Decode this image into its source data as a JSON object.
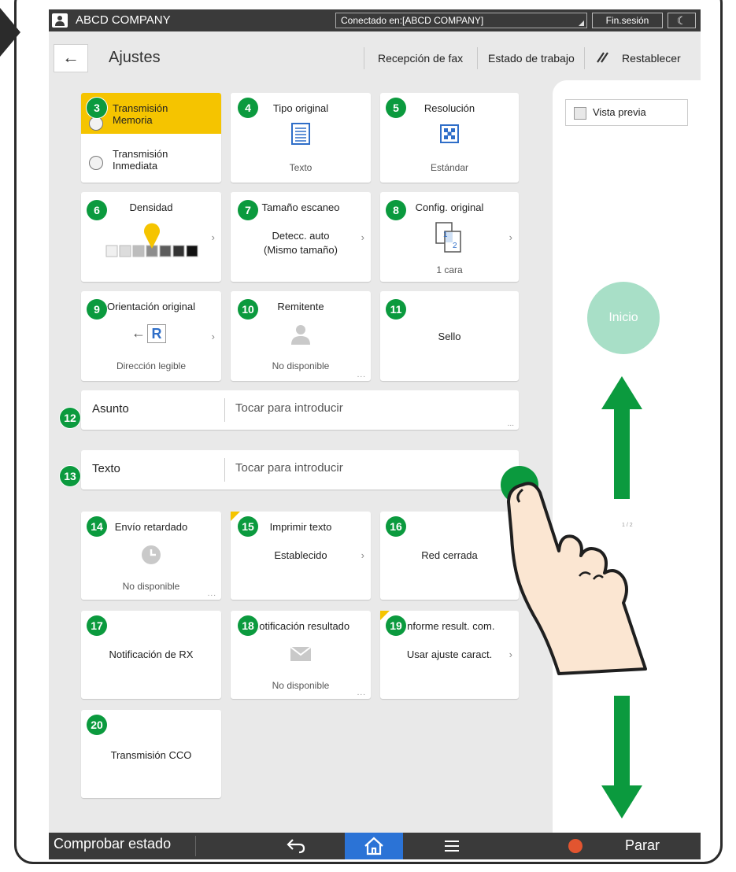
{
  "topbar": {
    "company": "ABCD COMPANY",
    "connected": "Conectado en:[ABCD COMPANY]",
    "logout": "Fin.sesión"
  },
  "header": {
    "title": "Ajustes",
    "links": [
      "Recepción de fax",
      "Estado de trabajo",
      "Restablecer"
    ]
  },
  "tiles": {
    "transmission": {
      "badge": "3",
      "memory_label_1": "Transmisión",
      "memory_label_2": "Memoria",
      "immediate_label_1": "Transmisión",
      "immediate_label_2": "Inmediata",
      "selected": "memory"
    },
    "original_type": {
      "badge": "4",
      "title": "Tipo original",
      "value": "Texto"
    },
    "resolution": {
      "badge": "5",
      "title": "Resolución",
      "value": "Estándar"
    },
    "density": {
      "badge": "6",
      "title": "Densidad",
      "level": 4,
      "levels": 7
    },
    "scan_size": {
      "badge": "7",
      "title": "Tamaño escaneo",
      "value_1": "Detecc. auto",
      "value_2": "(Mismo tamaño)"
    },
    "original_config": {
      "badge": "8",
      "title": "Config. original",
      "value": "1 cara",
      "page1": "1",
      "page2": "2"
    },
    "orientation": {
      "badge": "9",
      "title": "Orientación original",
      "value": "Dirección legible",
      "letter": "R"
    },
    "sender": {
      "badge": "10",
      "title": "Remitente",
      "value": "No disponible"
    },
    "stamp": {
      "badge": "11",
      "title": "Sello"
    },
    "delayed": {
      "badge": "14",
      "title": "Envío retardado",
      "value": "No disponible"
    },
    "print_text": {
      "badge": "15",
      "title": "Imprimir texto",
      "value": "Establecido"
    },
    "closed_net": {
      "badge": "16",
      "title": "Red cerrada"
    },
    "rx_notify": {
      "badge": "17",
      "title": "Notificación de RX"
    },
    "result_notify": {
      "badge": "18",
      "title": "Notificación resultado",
      "value": "No disponible"
    },
    "comm_report": {
      "badge": "19",
      "title": "Informe result. com.",
      "value": "Usar ajuste caract."
    },
    "bcc": {
      "badge": "20",
      "title": "Transmisión CCO"
    }
  },
  "fields": {
    "subject": {
      "badge": "12",
      "label": "Asunto",
      "placeholder": "Tocar para introducir"
    },
    "text": {
      "badge": "13",
      "label": "Texto",
      "placeholder": "Tocar para introducir"
    }
  },
  "right_panel": {
    "preview": "Vista previa",
    "start": "Inicio",
    "pager": "1 / 2"
  },
  "bottombar": {
    "status": "Comprobar estado",
    "stop": "Parar"
  },
  "colors": {
    "badge": "#0b9a3e",
    "selected": "#f5c400",
    "start": "#a8dfc7",
    "home": "#2b73d6",
    "arrow": "#0b9a3e"
  }
}
